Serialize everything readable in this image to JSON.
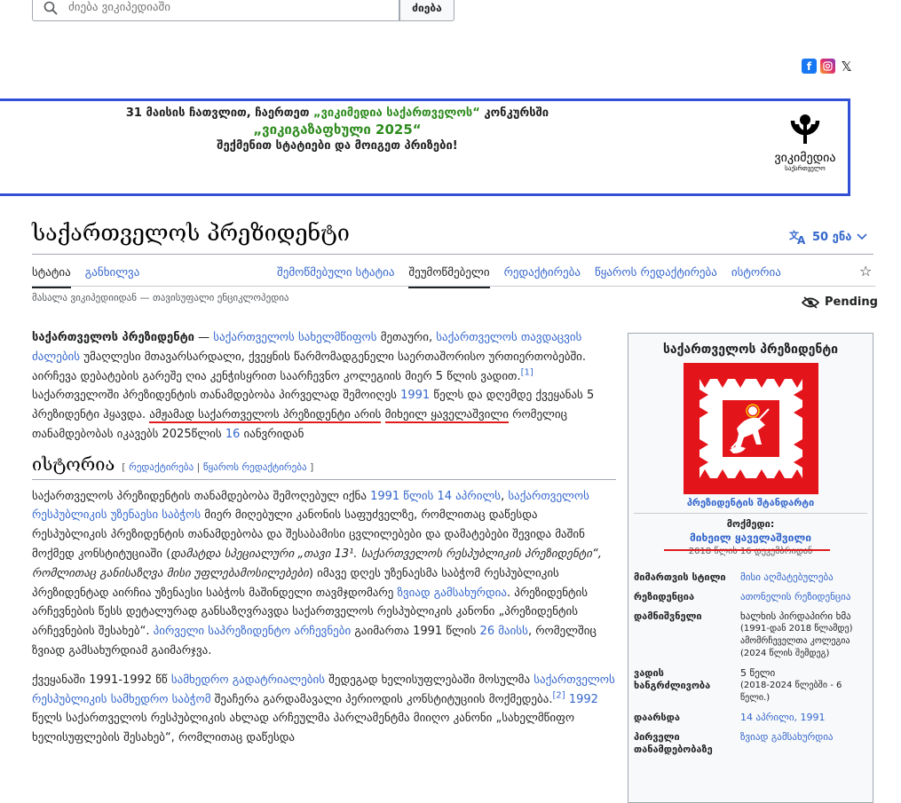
{
  "search": {
    "placeholder": "ძიება ვიკიპედიაში",
    "button_label": "ძიება"
  },
  "social": {
    "icons": [
      "facebook-icon",
      "instagram-icon",
      "x-icon"
    ],
    "x_glyph": "𝕏",
    "fb_glyph": "f"
  },
  "banner": {
    "line1_a": "31 მაისის ჩათვლით, ჩაერთეთ",
    "line1_link": "„ვიკიმედია საქართველოს“",
    "line1_b": "კონკურსში",
    "line2": "„ვიკიგაზაფხული 2025“",
    "line3": "შექმენით სტატიები და მოიგეთ პრიზები!",
    "logo_name": "ვიკიმედია",
    "logo_sub": "საქართველო"
  },
  "page": {
    "title": "საქართველოს პრეზიდენტი",
    "languages": "50 ენა",
    "from_wp": "მასალა ვიკიპედიიდან — თავისუფალი ენციკლოპედია",
    "pending": "Pending"
  },
  "tabs": {
    "article": "სტატია",
    "talk": "განხილვა",
    "reviewed": "შემოწმებული სტატია",
    "unreviewed": "შეუმოწმებელი",
    "edit": "რედაქტირება",
    "edit_source": "წყაროს რედაქტირება",
    "history": "ისტორია"
  },
  "intro": {
    "bold": "საქართველოს პრეზიდენტი",
    "t1": " — ",
    "l1": "საქართველოს სახელმწიფოს",
    "t2": " მეთაური, ",
    "l2": "საქართველოს თავდაცვის ძალების",
    "t3": " უმაღლესი მთავარსარდალი, ქვეყნის წარმომადგენელი საერთაშორისო ურთიერთობებში. აირჩევა დებატების გარეშე ღია კენჭისყრით საარჩევნო კოლეგიის მიერ 5 წლის ვადით.",
    "ref1": "[1]",
    "t4": " საქართველოში პრეზიდენტის თანამდებობა პირველად შემოიღეს ",
    "l3": "1991",
    "t5": " წელს და დღემდე ქვეყანას 5 პრეზიდენტი ჰყავდა. ",
    "red1": "ამჟამად საქართველოს პრეზიდენტი არის",
    "t6": " ",
    "red2": "მიხეილ ყაველაშვილი",
    "t7": " რომელიც თანამდებობას იკავებს 2025წლის ",
    "l4": "16",
    "t8": " იანვრიდან"
  },
  "history": {
    "heading": "ისტორია",
    "edit_open": "[ ",
    "edit": "რედაქტირება",
    "edit_sep": " | ",
    "edit_source": "წყაროს რედაქტირება",
    "edit_close": " ]",
    "p1_t1": "საქართველოს პრეზიდენტის თანამდებობა შემოღებულ იქნა ",
    "p1_l1": "1991 წლის 14 აპრილს",
    "p1_t2": ", ",
    "p1_l2": "საქართველოს რესპუბლიკის უზენაესი საბჭოს",
    "p1_t3": " მიერ მიღებული კანონის საფუძველზე, რომლითაც დაწესდა რესპუბლიკის პრეზიდენტის თანამდებობა და შესაბამისი ცვლილებები და დამატებები შევიდა მაშინ მოქმედ კონსტიტუციაში (",
    "p1_it": "დამატდა სპეციალური „თავი 13¹. საქართველოს რესპუბლიკის პრეზიდენტი“, რომლითაც განისაზღვა მისი უფლებამოსილებები",
    "p1_t4": ") იმავე დღეს უზენაესმა საბჭომ რესპუბლიკის პრეზიდენტად აირჩია უზენაესი საბჭოს მაშინდელი თავმჯდომარე ",
    "p1_l3": "ზვიად გამსახურდია",
    "p1_t5": ". პრეზიდენტის არჩევნების წესს დეტალურად განსაზღვრავდა საქართველოს რესპუბლიკის კანონი „პრეზიდენტის არჩევნების შესახებ“. ",
    "p1_l4": "პირველი საპრეზიდენტო არჩევნები",
    "p1_t6": " გაიმართა 1991 წლის ",
    "p1_l5": "26 მაისს",
    "p1_t7": ", რომელშიც ზვიად გამსახურდიამ გაიმარჯვა.",
    "p2_t1": "ქვეყანაში 1991-1992 წწ ",
    "p2_l1": "სამხედრო გადატრიალების",
    "p2_t2": " შედეგად ხელისუფლებაში მოსულმა ",
    "p2_l2": "საქართველოს რესპუბლიკის სამხედრო საბჭომ",
    "p2_t3": " შეაჩერა გარდამავალი პერიოდის კონსტიტუციის მოქმედება.",
    "p2_ref": "[2]",
    "p2_t4": " ",
    "p2_l3": "1992",
    "p2_t5": " წელს საქართველოს რესპუბლიკის ახლად არჩეულმა პარლამენტმა მიიღო კანონი „სახელმწიფო ხელისუფლების შესახებ“, რომლითაც დაწესდა"
  },
  "infobox": {
    "title": "საქართველოს პრეზიდენტი",
    "caption": "პრეზიდენტის შტანდარტი",
    "incumbent_label": "მოქმედი:",
    "incumbent_name": "მიხეილ ყაველაშვილი",
    "incumbent_date": "2018 წლის 16 დეკემბრიდან",
    "rows": [
      {
        "k": "მიმართვის სტილი",
        "v": "მისი აღმატებულება",
        "link": true
      },
      {
        "k": "რეზიდენცია",
        "v": "ათონელის რეზიდენცია",
        "link": true
      },
      {
        "k": "დამნიშვნელი",
        "v": "ხალხის პირდაპირი ხმა",
        "v2": "(1991-დან 2018 წლამდე)",
        "v3": "ამომრჩეველთა კოლეგია (2024 წლის შემდეგ)",
        "link": false
      },
      {
        "k": "ვადის ხანგრძლივობა",
        "v": "5 წელი",
        "v2": "(2018-2024 წლებში - 6 წელი.)",
        "link": false
      },
      {
        "k": "დაარსდა",
        "v": "14 აპრილი, 1991",
        "link": true
      },
      {
        "k": "პირველი თანამდებობაზე",
        "v": "ზვიად გამსახურდია",
        "link": true
      }
    ]
  }
}
